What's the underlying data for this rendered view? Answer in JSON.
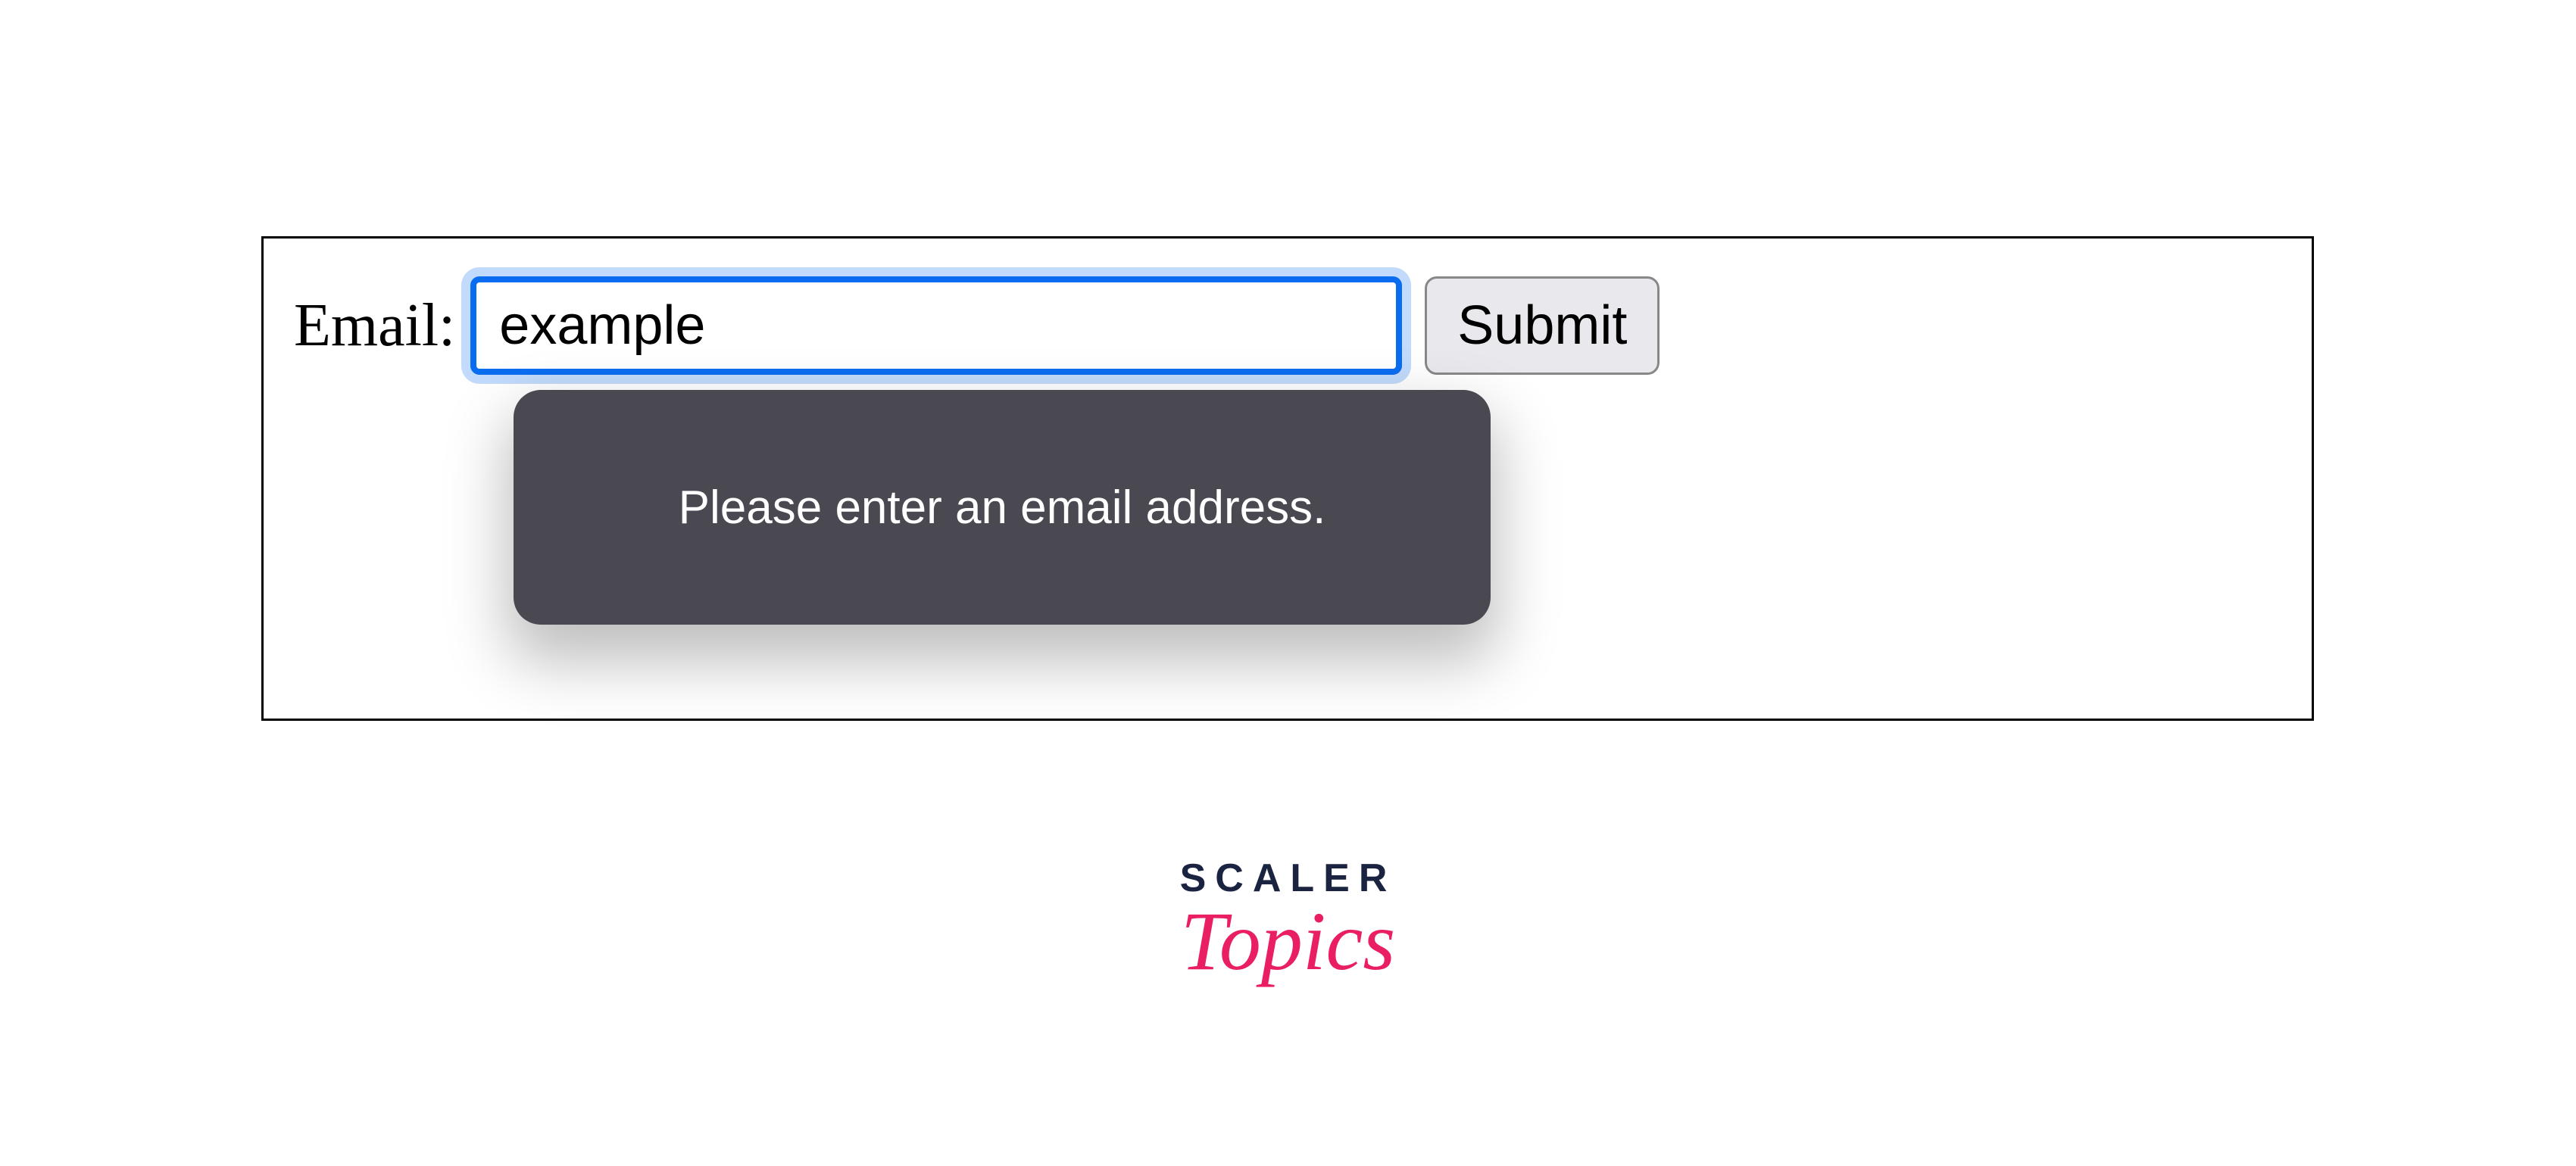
{
  "form": {
    "email_label": "Email:",
    "email_value": "example",
    "submit_label": "Submit",
    "validation_message": "Please enter an email address."
  },
  "logo": {
    "line1": "SCALER",
    "line2": "Topics"
  }
}
